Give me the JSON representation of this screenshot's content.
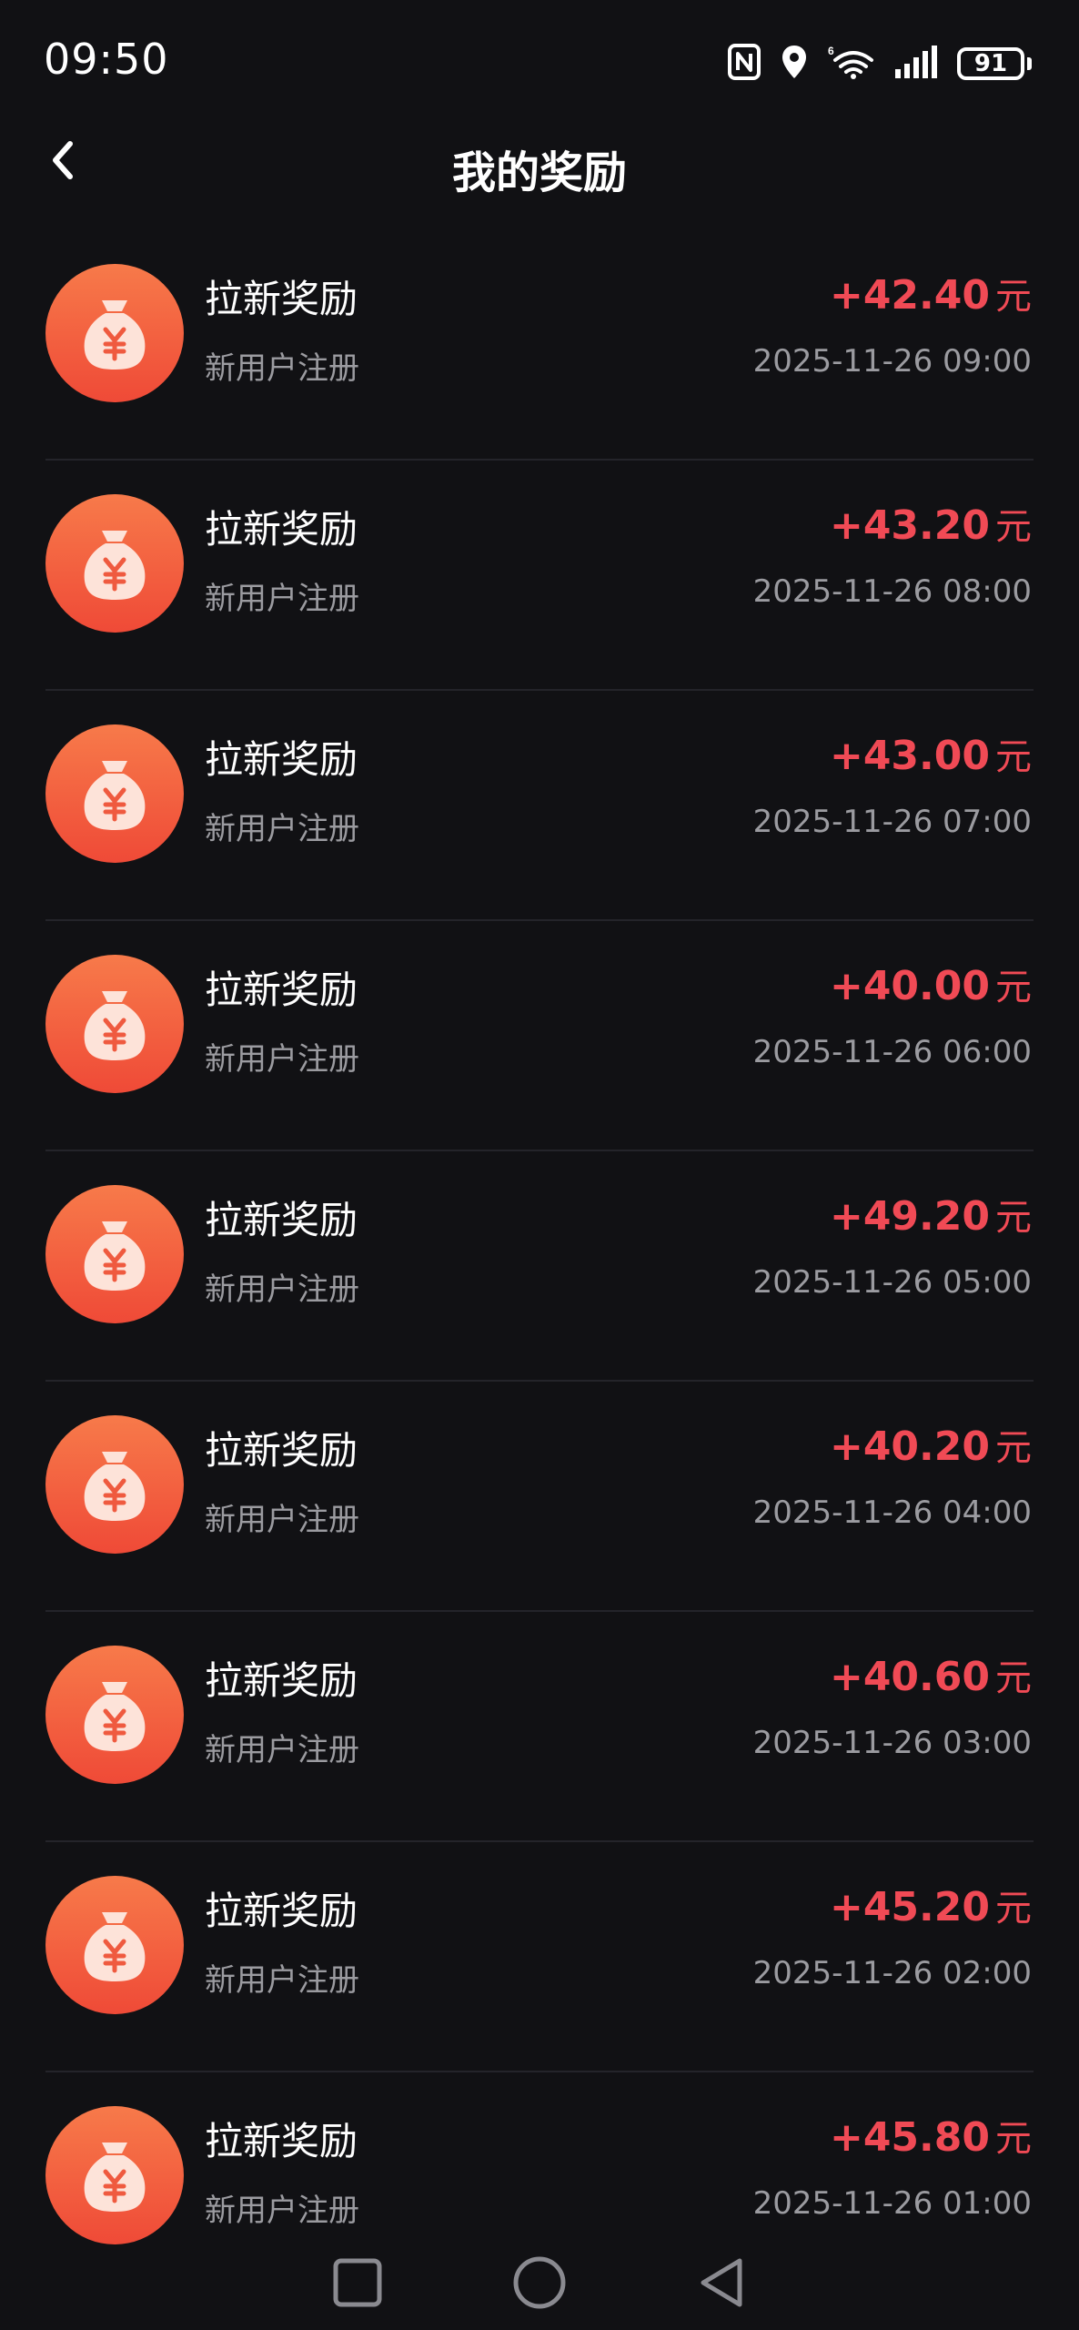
{
  "status_bar": {
    "time": "09:50",
    "battery": "91",
    "icons": [
      "nfc-icon",
      "location-icon",
      "wifi-icon",
      "signal-icon",
      "battery-icon"
    ]
  },
  "header": {
    "title": "我的奖励",
    "back_icon": "chevron-left-icon"
  },
  "colors": {
    "background": "#111114",
    "amount": "#f04a55",
    "icon_gradient_top": "#f77a4a",
    "icon_gradient_bottom": "#ef4a37",
    "secondary_text": "#9b9ba0"
  },
  "rewards": [
    {
      "title": "拉新奖励",
      "subtitle": "新用户注册",
      "amount": "+42.40",
      "unit": "元",
      "time": "2025-11-26 09:00"
    },
    {
      "title": "拉新奖励",
      "subtitle": "新用户注册",
      "amount": "+43.20",
      "unit": "元",
      "time": "2025-11-26 08:00"
    },
    {
      "title": "拉新奖励",
      "subtitle": "新用户注册",
      "amount": "+43.00",
      "unit": "元",
      "time": "2025-11-26 07:00"
    },
    {
      "title": "拉新奖励",
      "subtitle": "新用户注册",
      "amount": "+40.00",
      "unit": "元",
      "time": "2025-11-26 06:00"
    },
    {
      "title": "拉新奖励",
      "subtitle": "新用户注册",
      "amount": "+49.20",
      "unit": "元",
      "time": "2025-11-26 05:00"
    },
    {
      "title": "拉新奖励",
      "subtitle": "新用户注册",
      "amount": "+40.20",
      "unit": "元",
      "time": "2025-11-26 04:00"
    },
    {
      "title": "拉新奖励",
      "subtitle": "新用户注册",
      "amount": "+40.60",
      "unit": "元",
      "time": "2025-11-26 03:00"
    },
    {
      "title": "拉新奖励",
      "subtitle": "新用户注册",
      "amount": "+45.20",
      "unit": "元",
      "time": "2025-11-26 02:00"
    },
    {
      "title": "拉新奖励",
      "subtitle": "新用户注册",
      "amount": "+45.80",
      "unit": "元",
      "time": "2025-11-26 01:00"
    }
  ],
  "nav_bar": {
    "buttons": [
      "recent-apps-icon",
      "home-icon",
      "back-triangle-icon"
    ]
  }
}
